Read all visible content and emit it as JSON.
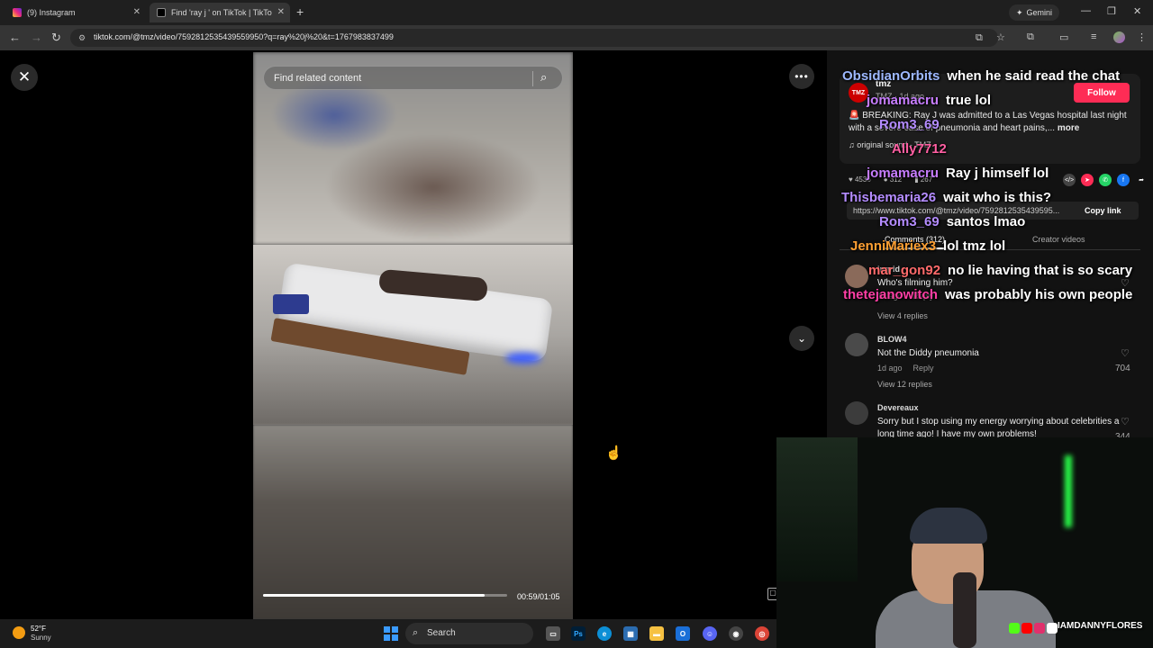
{
  "browser": {
    "tabs": [
      {
        "title": "(9) Instagram"
      },
      {
        "title": "Find 'ray j ' on TikTok | TikTo"
      }
    ],
    "gemini_label": "Gemini",
    "url": "tiktok.com/@tmz/video/7592812535439559950?q=ray%20j%20&t=1767983837499"
  },
  "video": {
    "search_placeholder": "Find related content",
    "time": "00:59/01:05",
    "progress_fraction": 0.9077
  },
  "author": {
    "name": "tmz",
    "meta": "TMZ · 1d ago",
    "follow_label": "Follow",
    "caption": "🚨 BREAKING: Ray J was admitted to a Las Vegas hospital last night with a severe case of pneumonia and heart pains,...",
    "caption_more": "more",
    "sound": "original sound - TMZ"
  },
  "stats": {
    "likes": "4536",
    "comments": "312",
    "saves": "267"
  },
  "link": {
    "text": "https://www.tiktok.com/@tmz/video/7592812535439595...",
    "copy_label": "Copy link"
  },
  "panel_tabs": [
    {
      "label": "Comments (312)"
    },
    {
      "label": "Creator videos"
    }
  ],
  "comments": [
    {
      "user": "ingrid",
      "text": "Who's filming him?",
      "date": "1d ago",
      "reply": "Reply",
      "likes": "",
      "view_replies": "View 4 replies"
    },
    {
      "user": "BLOW4",
      "text": "Not the Diddy pneumonia",
      "date": "1d ago",
      "reply": "Reply",
      "likes": "704",
      "view_replies": "View 12 replies"
    },
    {
      "user": "Devereaux",
      "text": "Sorry but I stop using my energy worrying about celebrities a long time ago! I have my own problems!",
      "date": "",
      "reply": "",
      "likes": "344",
      "view_replies": ""
    }
  ],
  "chat": [
    {
      "user": "ObsidianOrbits",
      "msg": "when he said read the chat",
      "color": "#9db8ff"
    },
    {
      "user": "jomamacru",
      "msg": "true lol",
      "color": "#c77dff"
    },
    {
      "user": "Rom3_69",
      "msg": "",
      "color": "#b48cff"
    },
    {
      "user": "Ally7712",
      "msg": "",
      "color": "#ff5fa2"
    },
    {
      "user": "jomamacru",
      "msg": "Ray j himself lol",
      "color": "#c77dff"
    },
    {
      "user": "Thisbemaria26",
      "msg": "wait who is this?",
      "color": "#b48cff"
    },
    {
      "user": "Rom3_69",
      "msg": "santos lmao",
      "color": "#b48cff"
    },
    {
      "user": "JenniMariex3",
      "msg": "lol tmz lol",
      "color": "#ffa033"
    },
    {
      "user": "mar_gon92",
      "msg": "no lie having that is so scary",
      "color": "#ff6b6b"
    },
    {
      "user": "thetejanowitch",
      "msg": "was probably his own people",
      "color": "#ff3fa5"
    }
  ],
  "webcam": {
    "handle": "IAMDANNYFLORES"
  },
  "taskbar": {
    "temp": "52°F",
    "condition": "Sunny",
    "search_label": "Search"
  },
  "icons": [
    "close-icon",
    "search-icon",
    "more-icon",
    "chevron-down-icon",
    "heart-icon",
    "comment-icon",
    "bookmark-icon",
    "share-icon",
    "music-icon",
    "windows-icon"
  ]
}
